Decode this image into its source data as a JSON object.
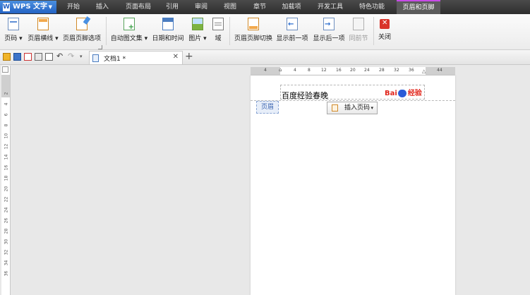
{
  "app": {
    "name": "WPS 文字",
    "logo": "W"
  },
  "menu": {
    "tabs": [
      {
        "label": "开始"
      },
      {
        "label": "插入"
      },
      {
        "label": "页面布局"
      },
      {
        "label": "引用"
      },
      {
        "label": "审阅"
      },
      {
        "label": "视图"
      },
      {
        "label": "章节"
      },
      {
        "label": "加载项"
      },
      {
        "label": "开发工具"
      },
      {
        "label": "特色功能"
      },
      {
        "label": "页眉和页脚",
        "active": true
      }
    ]
  },
  "ribbon": {
    "buttons": [
      {
        "label": "页码 ▾",
        "icon": "page-number-icon"
      },
      {
        "label": "页眉横线 ▾",
        "icon": "header-line-icon"
      },
      {
        "label": "页眉页脚选项",
        "icon": "header-footer-options-icon"
      },
      {
        "label": "自动图文集 ▾",
        "icon": "autotext-icon"
      },
      {
        "label": "日期和时间",
        "icon": "calendar-icon"
      },
      {
        "label": "图片 ▾",
        "icon": "picture-icon"
      },
      {
        "label": "域",
        "icon": "field-icon"
      },
      {
        "label": "页眉页脚切换",
        "icon": "switch-header-footer-icon"
      },
      {
        "label": "显示前一项",
        "icon": "show-previous-icon"
      },
      {
        "label": "显示后一项",
        "icon": "show-next-icon"
      },
      {
        "label": "同前节",
        "icon": "same-as-previous-icon",
        "disabled": true
      },
      {
        "label": "关闭",
        "icon": "close-icon"
      }
    ]
  },
  "doc_tab": {
    "name": "文档1 *",
    "close": "✕",
    "new": "+"
  },
  "ruler": {
    "h_ticks": [
      "4",
      "4",
      "8",
      "12",
      "16",
      "20",
      "24",
      "28",
      "32",
      "36",
      "44"
    ],
    "v_ticks": [
      "2",
      "4",
      "6",
      "8",
      "10",
      "12",
      "14",
      "16",
      "18",
      "20",
      "22",
      "24",
      "26",
      "28",
      "30",
      "32",
      "34",
      "36"
    ]
  },
  "document": {
    "header_text": "百度经验春晚",
    "header_label": "页眉",
    "insert_page_number": "插入页码",
    "logo": {
      "bai": "Bai",
      "du": "du",
      "jingyan": "经验"
    }
  }
}
